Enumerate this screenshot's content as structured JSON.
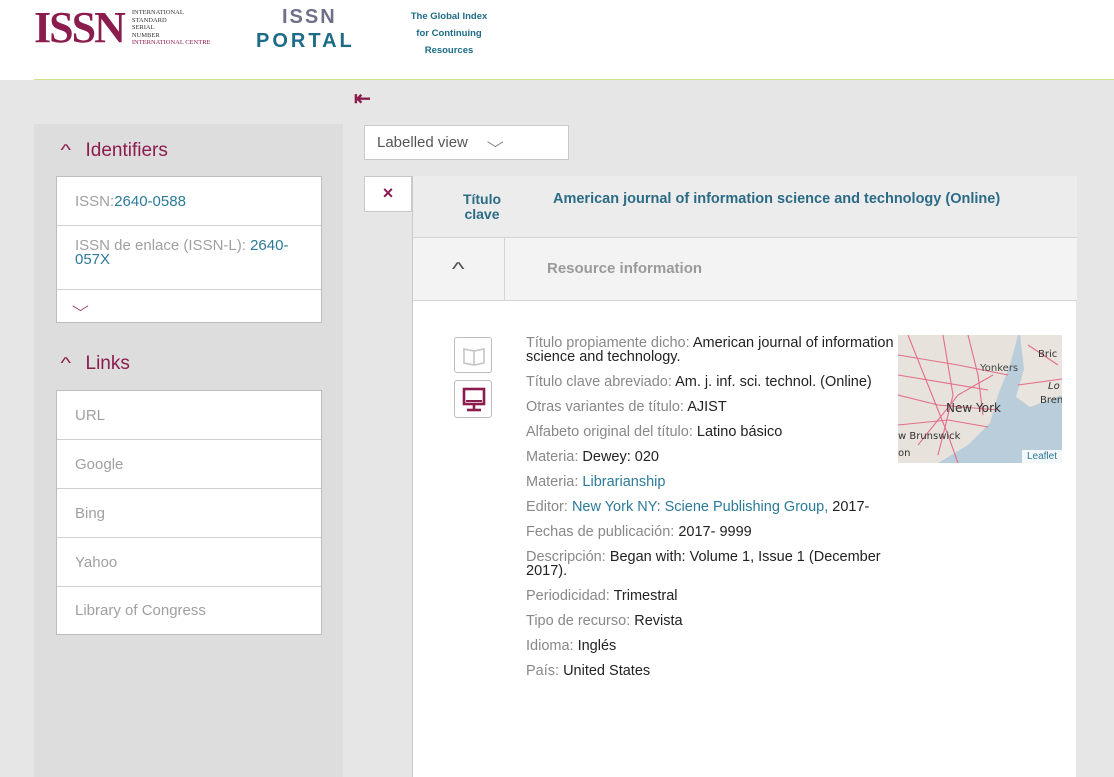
{
  "header": {
    "issn_mark": "ISSN",
    "issn_words": [
      "INTERNATIONAL",
      "STANDARD",
      "SERIAL",
      "NUMBER"
    ],
    "issn_centre": "INTERNATIONAL CENTRE",
    "portal_top": "ISSN",
    "portal_bottom": "PORTAL",
    "tagline": [
      "The Global Index",
      "for Continuing",
      "Resources"
    ]
  },
  "sidebar": {
    "identifiers": {
      "heading": "Identifiers",
      "issn_label": "ISSN:",
      "issn_value": "2640-0588",
      "issnl_label": "ISSN de enlace (ISSN-L):",
      "issnl_value": "2640-057X"
    },
    "links": {
      "heading": "Links",
      "items": [
        "URL",
        "Google",
        "Bing",
        "Yahoo",
        "Library of Congress"
      ]
    }
  },
  "main": {
    "view_select": "Labelled view",
    "close_symbol": "×",
    "title_label": "Título clave",
    "title_value": "American journal of information science and technology (Online)",
    "resource_heading": "Resource information",
    "fields": [
      {
        "label": "Título propiamente dicho: ",
        "value": "American journal of information science and technology."
      },
      {
        "label": "Título clave abreviado: ",
        "value": "Am. j. inf. sci. technol. (Online)"
      },
      {
        "label": "Otras variantes de título: ",
        "value": "AJIST"
      },
      {
        "label": "Alfabeto original del título: ",
        "value": "Latino básico"
      },
      {
        "label": "Materia: ",
        "value": "Dewey: 020"
      },
      {
        "label": "Materia: ",
        "link": "Librarianship"
      },
      {
        "label": "Editor: ",
        "link": "New York NY: Sciene Publishing Group,",
        "value": " 2017-"
      },
      {
        "label": "Fechas de publicación: ",
        "value": "2017- 9999"
      },
      {
        "label": "Descripción: ",
        "value": "Began with: Volume 1, Issue 1 (December 2017)."
      },
      {
        "label": "Periodicidad: ",
        "value": "Trimestral"
      },
      {
        "label": "Tipo de recurso: ",
        "value": "Revista"
      },
      {
        "label": "Idioma: ",
        "value": "Inglés"
      },
      {
        "label": "País: ",
        "value": "United States"
      }
    ],
    "map": {
      "labels": [
        "Yonkers",
        "New York",
        "w Brunswick",
        "on",
        "Bric",
        "Bren",
        "Lo"
      ],
      "attribution": "Leaflet"
    }
  }
}
